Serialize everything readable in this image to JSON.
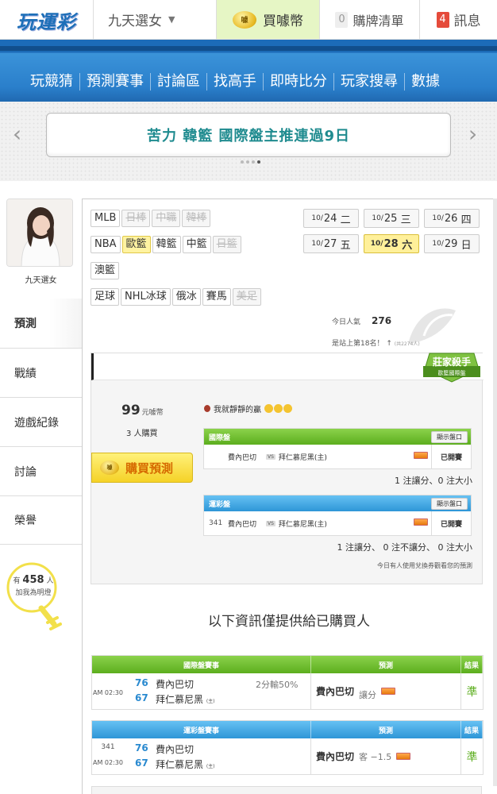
{
  "header": {
    "logo": "玩運彩",
    "user_name": "九天選女",
    "buy_coin_label": "買噱幣",
    "coin_icon_text": "噱",
    "cart_count": "0",
    "cart_label": "購牌清單",
    "message_count": "4",
    "message_label": "訊息"
  },
  "nav": [
    "玩競猜",
    "預測賽事",
    "討論區",
    "找高手",
    "即時比分",
    "玩家搜尋",
    "數據"
  ],
  "promo": {
    "text": "苦力 韓籃 國際盤主推連過9日",
    "left_arrow": "‹",
    "right_arrow": "›"
  },
  "sidebar": {
    "name": "九天選女",
    "items": [
      "預測",
      "戰績",
      "遊戲紀錄",
      "討論",
      "榮譽"
    ],
    "fans_prefix": "有",
    "fans_count": "458",
    "fans_unit": "人",
    "fans_text": "加我為明燈"
  },
  "leagues": [
    {
      "label": "MLB",
      "state": "normal"
    },
    {
      "label": "日棒",
      "state": "disabled"
    },
    {
      "label": "中職",
      "state": "disabled"
    },
    {
      "label": "韓棒",
      "state": "disabled"
    },
    {
      "label": "NBA",
      "state": "normal"
    },
    {
      "label": "歐籃",
      "state": "selected"
    },
    {
      "label": "韓籃",
      "state": "normal"
    },
    {
      "label": "中籃",
      "state": "normal"
    },
    {
      "label": "日籃",
      "state": "disabled"
    },
    {
      "label": "澳籃",
      "state": "normal"
    },
    {
      "label": "足球",
      "state": "normal"
    },
    {
      "label": "NHL冰球",
      "state": "normal"
    },
    {
      "label": "俄冰",
      "state": "normal"
    },
    {
      "label": "賽馬",
      "state": "normal"
    },
    {
      "label": "美足",
      "state": "disabled"
    }
  ],
  "dates": [
    {
      "month": "10/",
      "day": "24",
      "dow": "二",
      "selected": false
    },
    {
      "month": "10/",
      "day": "25",
      "dow": "三",
      "selected": false
    },
    {
      "month": "10/",
      "day": "26",
      "dow": "四",
      "selected": false
    },
    {
      "month": "10/",
      "day": "27",
      "dow": "五",
      "selected": false
    },
    {
      "month": "10/",
      "day": "28",
      "dow": "六",
      "selected": true
    },
    {
      "month": "10/",
      "day": "29",
      "dow": "日",
      "selected": false
    }
  ],
  "stats": {
    "pop_label": "今日人氣",
    "pop_value": "276",
    "rank_text": "是站上第18名！",
    "rank_arrow": "↑",
    "rank_small": "(共2274人)"
  },
  "badge": {
    "title": "莊家殺手",
    "sub": "歐籃國際盤"
  },
  "prediction": {
    "price": "99",
    "price_unit": "元噱幣",
    "buyers": "3 人購買",
    "buy_button": "購買預測",
    "comment": "我就靜靜的贏",
    "intl": {
      "header": "國際盤",
      "show_odds": "顯示盤口",
      "team1": "費內巴切",
      "vs": "VS",
      "team2": "拜仁慕尼黑(主)",
      "status": "已開賽",
      "summary": "1 注讓分、0 注大小"
    },
    "lottery": {
      "header": "運彩盤",
      "show_odds": "顯示盤口",
      "no": "341",
      "team1": "費內巴切",
      "vs": "VS",
      "team2": "拜仁慕尼黑(主)",
      "status": "已開賽",
      "summary": "1 注讓分、 0 注不讓分、 0 注大小"
    },
    "exchange_note": "今日有人使用兌換券觀看您的預測"
  },
  "info_title": "以下資訊僅提供給已購買人",
  "results": [
    {
      "header": {
        "game": "國際盤賽事",
        "pick": "預測",
        "result": "結果"
      },
      "line_no": "",
      "time": "AM 02:30",
      "score1": "76",
      "team1": "費內巴切",
      "handicap": "2分輸50%",
      "score2": "67",
      "team2": "拜仁慕尼黑",
      "home": "(主)",
      "pick_team": "費內巴切",
      "pick_type": "讓分",
      "outcome": "準"
    },
    {
      "header": {
        "game": "運彩盤賽事",
        "pick": "預測",
        "result": "結果"
      },
      "line_no": "341",
      "time": "AM 02:30",
      "score1": "76",
      "team1": "費內巴切",
      "handicap": "",
      "score2": "67",
      "team2": "拜仁慕尼黑",
      "home": "(主)",
      "pick_team": "費內巴切",
      "pick_type": "客 −1.5",
      "outcome": "準"
    }
  ]
}
